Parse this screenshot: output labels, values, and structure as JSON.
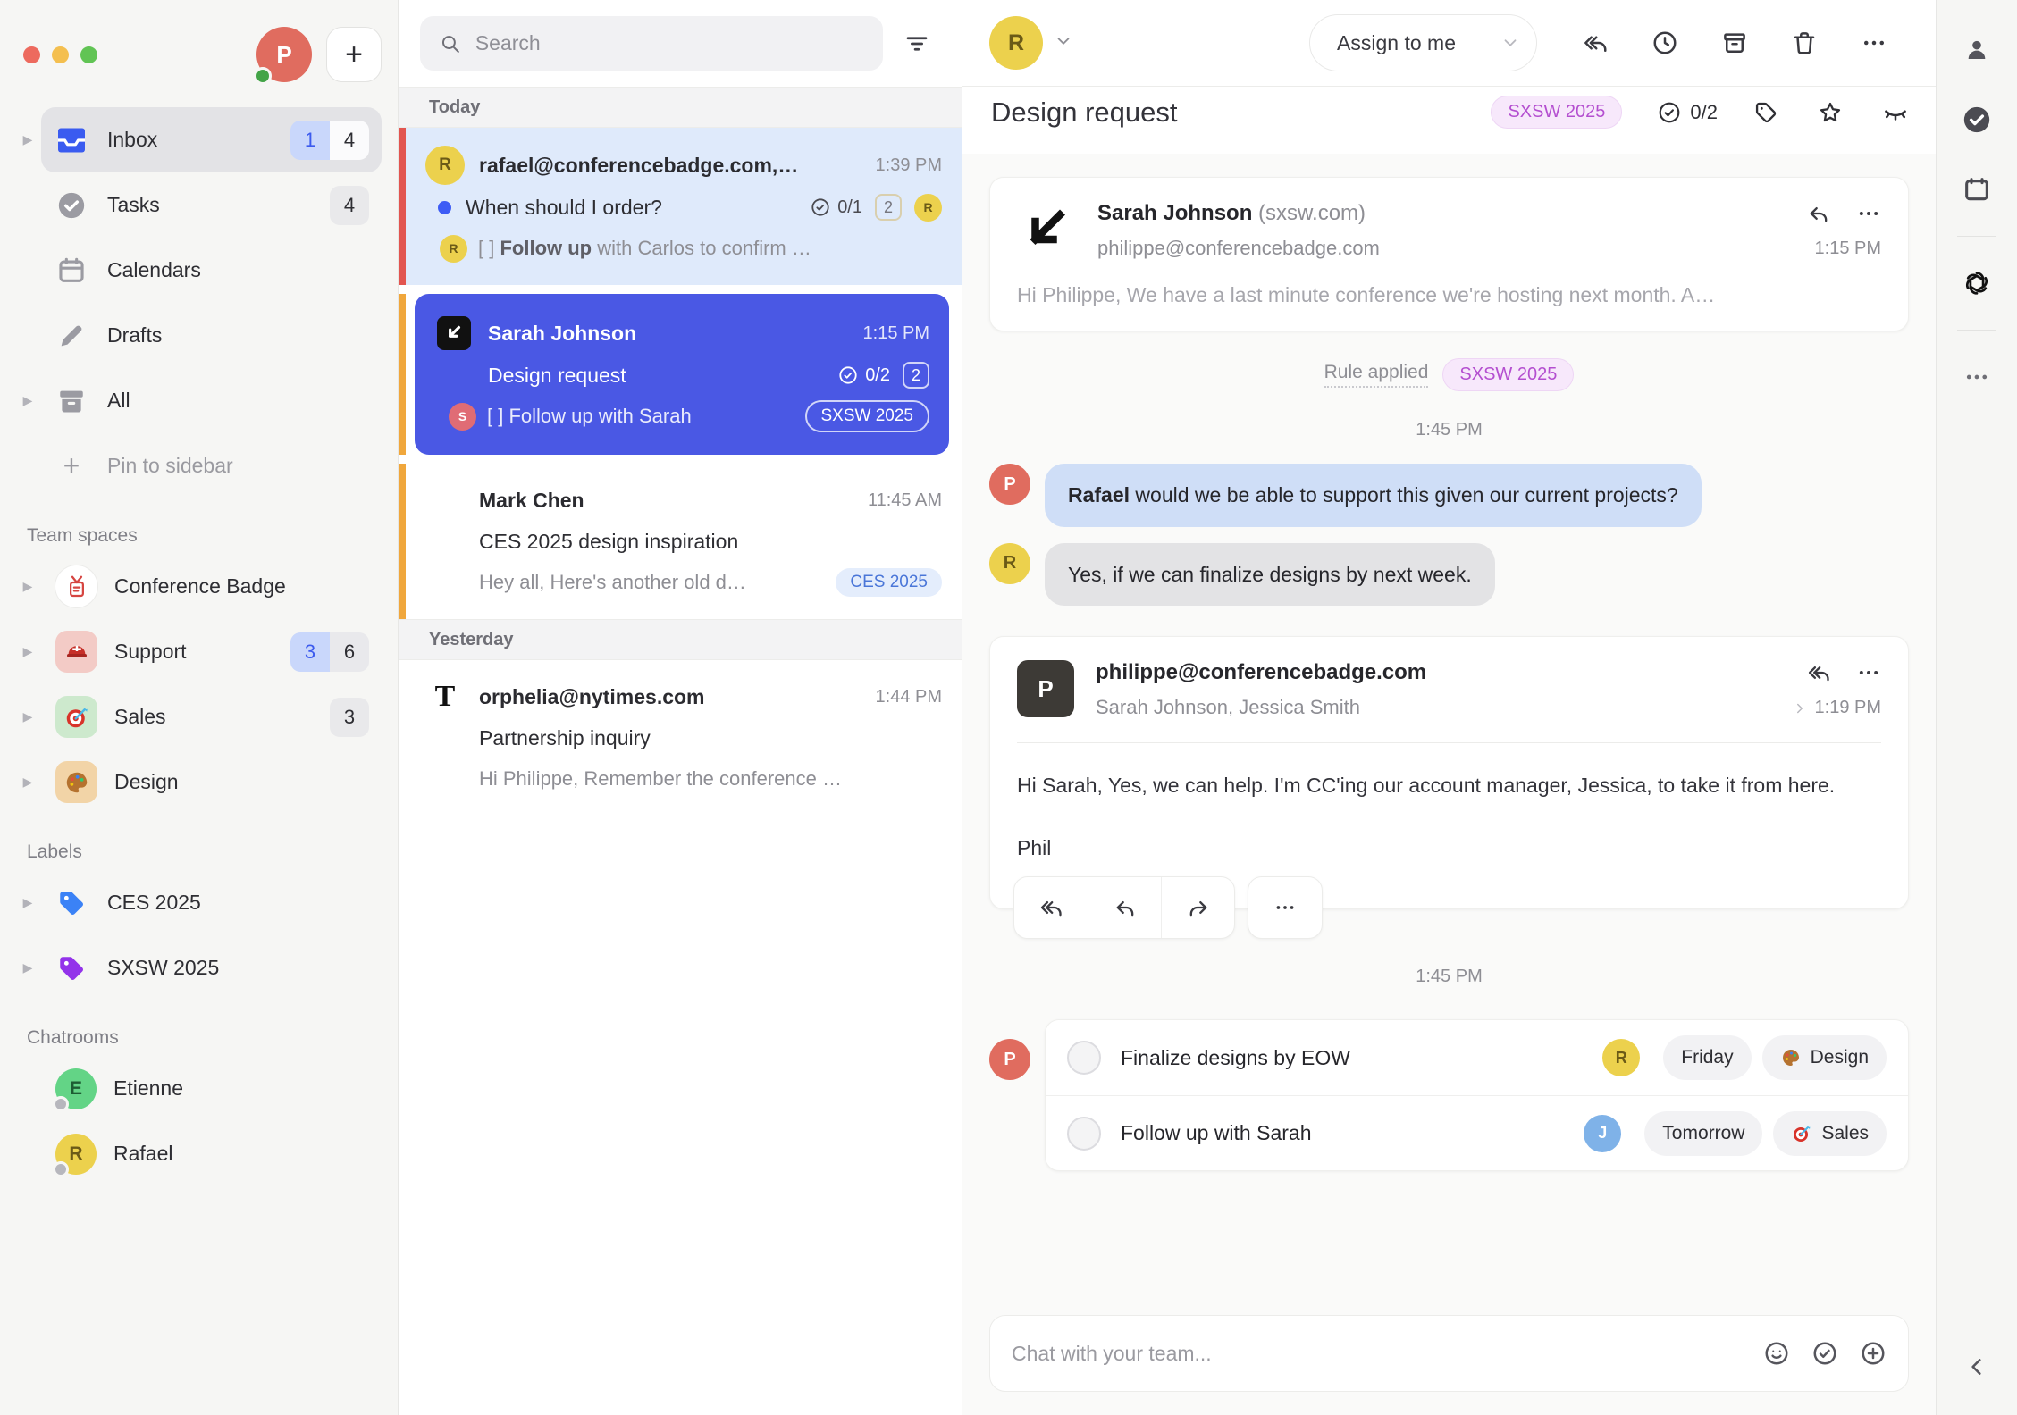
{
  "colors": {
    "accent_blue": "#4a58e4",
    "unread_row_bg": "#dfeafb",
    "strip_red": "#e25550",
    "strip_amber": "#f0a73c",
    "label_blue": "#3b82f6",
    "label_purple": "#9333ea",
    "pill_purple_text": "#b44fd0",
    "bubble_blue": "#cfdef7",
    "bubble_gray": "#e3e3e5"
  },
  "sidebar": {
    "user": {
      "initial": "P"
    },
    "new_button_label": "+",
    "items": [
      {
        "label": "Inbox",
        "unread": "1",
        "total": "4"
      },
      {
        "label": "Tasks",
        "total": "4"
      },
      {
        "label": "Calendars"
      },
      {
        "label": "Drafts"
      },
      {
        "label": "All"
      },
      {
        "label": "Pin to sidebar"
      }
    ],
    "sections": [
      {
        "title": "Team spaces",
        "items": [
          {
            "label": "Conference Badge"
          },
          {
            "label": "Support",
            "unread": "3",
            "total": "6"
          },
          {
            "label": "Sales",
            "total": "3"
          },
          {
            "label": "Design"
          }
        ]
      },
      {
        "title": "Labels",
        "items": [
          {
            "label": "CES 2025"
          },
          {
            "label": "SXSW 2025"
          }
        ]
      },
      {
        "title": "Chatrooms",
        "items": [
          {
            "label": "Etienne",
            "initial": "E"
          },
          {
            "label": "Rafael",
            "initial": "R"
          }
        ]
      }
    ]
  },
  "list": {
    "search_placeholder": "Search",
    "groups": [
      {
        "label": "Today"
      },
      {
        "label": "Yesterday"
      }
    ],
    "emails": [
      {
        "sender": "rafael@conferencebadge.com,…",
        "time": "1:39 PM",
        "subject": "When should I order?",
        "tasks": "0/1",
        "count": "2",
        "avatar_initial": "R",
        "task_prefix": "[ ]",
        "task_bold": "Follow up",
        "task_rest": " with Carlos to confirm …",
        "task_avatar_initial": "R"
      },
      {
        "sender": "Sarah Johnson",
        "time": "1:15 PM",
        "subject": "Design request",
        "tasks": "0/2",
        "count": "2",
        "task_prefix": "[ ]",
        "task_bold": "",
        "task_rest": "Follow up with Sarah",
        "task_avatar_initial": "S",
        "label": "SXSW 2025"
      },
      {
        "sender": "Mark Chen",
        "time": "11:45 AM",
        "subject": "CES 2025 design inspiration",
        "snippet": "Hey all, Here's another old d…",
        "label": "CES 2025"
      },
      {
        "sender": "orphelia@nytimes.com",
        "time": "1:44 PM",
        "subject": "Partnership inquiry",
        "snippet": "Hi Philippe, Remember the conference …",
        "nyt_glyph": "T"
      }
    ]
  },
  "toolbar": {
    "assign_label": "Assign to me",
    "assignee_initial": "R"
  },
  "conversation": {
    "title": "Design request",
    "label": "SXSW 2025",
    "task_count": "0/2",
    "email1": {
      "sender": "Sarah Johnson",
      "domain": " (sxsw.com)",
      "recipient": "philippe@conferencebadge.com",
      "time": "1:15 PM",
      "preview": "Hi Philippe, We have a last minute conference we're hosting next month. A…"
    },
    "rule": {
      "text": "Rule applied",
      "label": "SXSW 2025"
    },
    "chat_time": "1:45 PM",
    "messages": [
      {
        "bold": "Rafael",
        "text": " would we be able to support this given our current projects?",
        "initial": "P"
      },
      {
        "bold": "",
        "text": "Yes, if we can finalize designs by next week.",
        "initial": "R"
      }
    ],
    "email2": {
      "sender": "philippe@conferencebadge.com",
      "recipients": "Sarah Johnson, Jessica Smith",
      "time": "1:19 PM",
      "initial": "P",
      "body1": "Hi Sarah, Yes, we can help. I'm CC'ing our account manager, Jessica, to take it from here.",
      "body2": "Phil"
    },
    "tasks_time": "1:45 PM",
    "tasks_owner_initial": "P",
    "tasks": [
      {
        "title": "Finalize designs by EOW",
        "due": "Friday",
        "space": "Design",
        "assignee_initial": "R"
      },
      {
        "title": "Follow up with Sarah",
        "due": "Tomorrow",
        "space": "Sales",
        "assignee_initial": "J"
      }
    ],
    "chat_placeholder": "Chat with your team..."
  }
}
